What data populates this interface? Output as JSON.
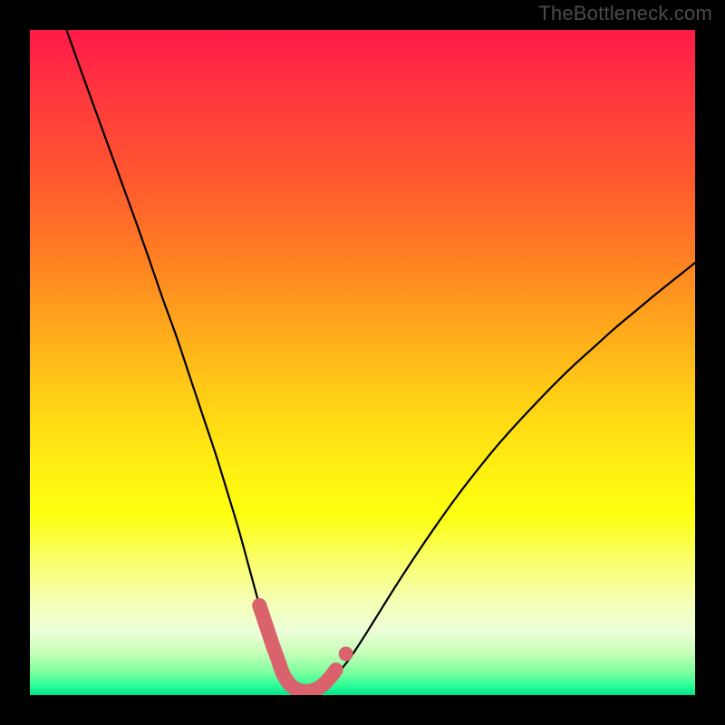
{
  "watermark": "TheBottleneck.com",
  "chart_data": {
    "type": "line",
    "title": "",
    "xlabel": "",
    "ylabel": "",
    "xlim": [
      0,
      100
    ],
    "ylim": [
      0,
      100
    ],
    "grid": false,
    "background_gradient": {
      "stops": [
        {
          "offset": 0.0,
          "color": "#ff1a49"
        },
        {
          "offset": 0.11,
          "color": "#ff3b3c"
        },
        {
          "offset": 0.22,
          "color": "#ff572f"
        },
        {
          "offset": 0.33,
          "color": "#ff7b24"
        },
        {
          "offset": 0.44,
          "color": "#ffa51c"
        },
        {
          "offset": 0.55,
          "color": "#ffce16"
        },
        {
          "offset": 0.66,
          "color": "#fff012"
        },
        {
          "offset": 0.73,
          "color": "#fdff10"
        },
        {
          "offset": 0.8,
          "color": "#f9ff6c"
        },
        {
          "offset": 0.86,
          "color": "#f5ffb6"
        },
        {
          "offset": 0.905,
          "color": "#ecffd8"
        },
        {
          "offset": 0.935,
          "color": "#c8ffb9"
        },
        {
          "offset": 0.965,
          "color": "#80ff9f"
        },
        {
          "offset": 0.985,
          "color": "#2fff99"
        },
        {
          "offset": 1.0,
          "color": "#00e38c"
        }
      ]
    },
    "series": [
      {
        "name": "bottleneck-curve",
        "color": "#000000",
        "x": [
          5.5,
          8,
          10,
          12,
          14,
          16,
          18,
          20,
          22,
          24,
          26,
          28,
          30,
          31.5,
          33,
          34.5,
          36,
          37,
          38,
          39,
          40,
          41,
          42,
          44,
          46,
          48,
          50,
          52,
          55,
          58,
          61,
          64,
          67,
          70,
          73,
          76,
          79,
          82,
          85,
          88,
          91,
          94,
          97,
          100
        ],
        "y": [
          100,
          93,
          87.5,
          82,
          76.5,
          71,
          65.3,
          59.5,
          54,
          48,
          42,
          36,
          29.5,
          24.5,
          19,
          13.5,
          8.2,
          5.2,
          3.0,
          1.6,
          0.8,
          0.5,
          0.6,
          1.3,
          3.0,
          5.4,
          8.4,
          11.6,
          16.4,
          21.0,
          25.4,
          29.6,
          33.5,
          37.2,
          40.6,
          43.8,
          46.9,
          49.8,
          52.5,
          55.2,
          57.7,
          60.2,
          62.6,
          65.0
        ]
      }
    ],
    "highlight_segment": {
      "name": "highlight-band",
      "color": "#d9626c",
      "x": [
        34.5,
        35.5,
        36.5,
        37.3,
        38.0,
        39.0,
        40.0,
        41.0,
        42.0,
        43.0,
        44.0,
        45.0,
        46.0
      ],
      "y": [
        13.5,
        10.5,
        7.5,
        5.3,
        3.3,
        1.7,
        0.9,
        0.6,
        0.6,
        0.9,
        1.5,
        2.5,
        3.8
      ],
      "dot": {
        "x": 47.5,
        "y": 6.2
      }
    }
  }
}
